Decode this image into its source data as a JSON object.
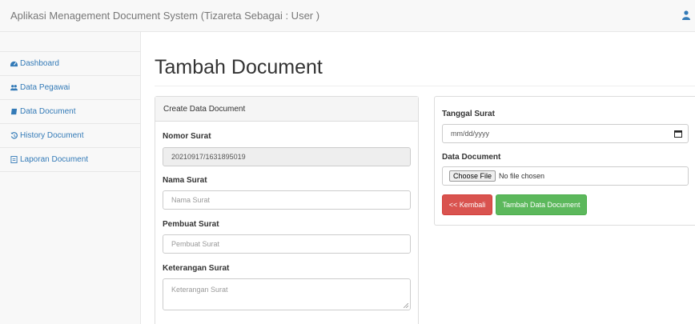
{
  "navbar": {
    "brand": "Aplikasi Menagement Document System (Tizareta Sebagai : User )",
    "user_icon": "user-icon"
  },
  "sidebar": {
    "items": [
      {
        "label": "Dashboard",
        "icon": "dashboard-icon"
      },
      {
        "label": "Data Pegawai",
        "icon": "users-icon"
      },
      {
        "label": "Data Document",
        "icon": "book-icon"
      },
      {
        "label": "History Document",
        "icon": "history-icon"
      },
      {
        "label": "Laporan Document",
        "icon": "report-icon"
      }
    ]
  },
  "main": {
    "title": "Tambah Document",
    "panel_heading": "Create Data Document",
    "form": {
      "nomor_surat": {
        "label": "Nomor Surat",
        "value": "20210917/1631895019"
      },
      "nama_surat": {
        "label": "Nama Surat",
        "placeholder": "Nama Surat"
      },
      "pembuat_surat": {
        "label": "Pembuat Surat",
        "placeholder": "Pembuat Surat"
      },
      "keterangan_surat": {
        "label": "Keterangan Surat",
        "placeholder": "Keterangan Surat"
      },
      "tanggal_surat": {
        "label": "Tanggal Surat",
        "placeholder": "mm/dd/yyyy"
      },
      "data_document": {
        "label": "Data Document",
        "button": "Choose File",
        "status": "No file chosen"
      }
    },
    "buttons": {
      "back": "<< Kembali",
      "submit": "Tambah Data Document"
    }
  },
  "colors": {
    "link": "#337ab7",
    "danger": "#d9534f",
    "success": "#5cb85c"
  }
}
